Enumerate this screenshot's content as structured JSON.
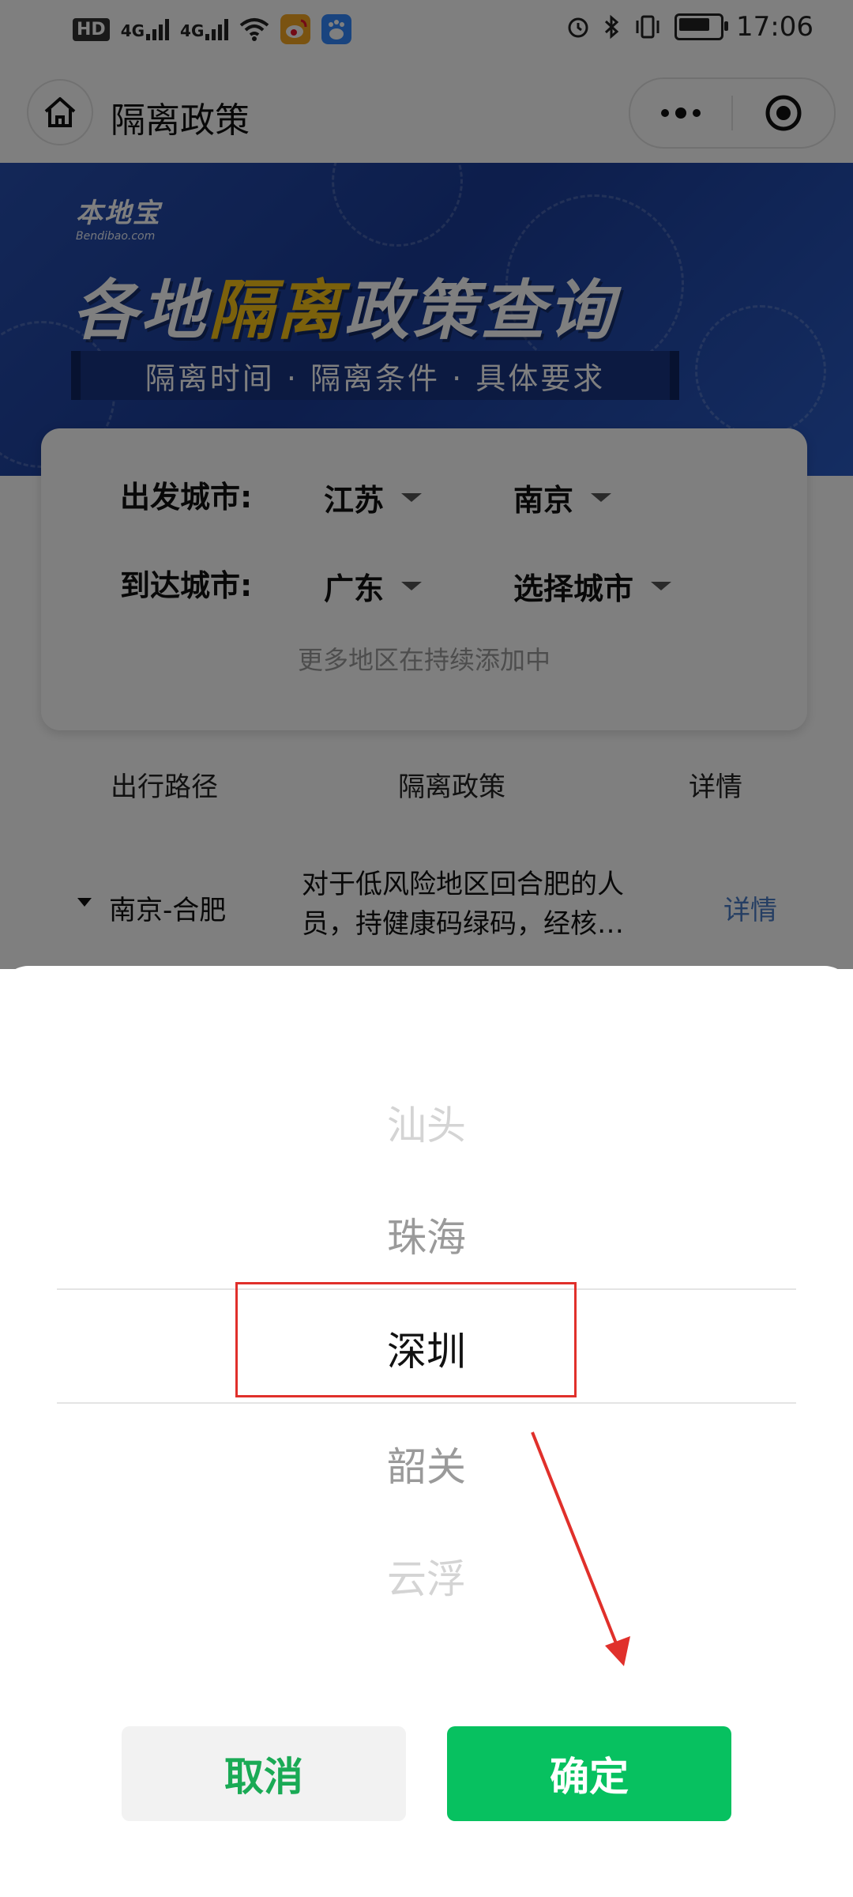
{
  "status_bar": {
    "hd": "HD",
    "network_1": "4G",
    "network_2": "4G",
    "time": "17:06",
    "icons": [
      "hd-icon",
      "signal-icon",
      "signal-icon",
      "wifi-icon",
      "weibo-app-icon",
      "baidu-app-icon",
      "alarm-icon",
      "bluetooth-icon",
      "vibrate-icon",
      "battery-icon"
    ]
  },
  "navbar": {
    "title": "隔离政策",
    "home_icon": "home-icon",
    "more_icon": "more-dots-icon",
    "close_icon": "target-close-icon"
  },
  "banner": {
    "logo_cn": "本地宝",
    "logo_en": "Bendibao.com",
    "title_part1": "各地",
    "title_highlight": "隔离",
    "title_part2": "政策查询",
    "subtitle": "隔离时间 · 隔离条件 · 具体要求",
    "colors": {
      "background": "#1a3c98",
      "highlight": "#f6c318"
    }
  },
  "query_card": {
    "departure_label": "出发城市:",
    "departure_province": "江苏",
    "departure_city": "南京",
    "arrival_label": "到达城市:",
    "arrival_province": "广东",
    "arrival_city": "选择城市",
    "note": "更多地区在持续添加中"
  },
  "table": {
    "headers": [
      "出行路径",
      "隔离政策",
      "详情"
    ],
    "rows": [
      {
        "route": "南京-合肥",
        "policy": "对于低风险地区回合肥的人员，持健康码绿码，经核…",
        "detail": "详情"
      }
    ]
  },
  "picker": {
    "options": [
      "汕头",
      "珠海",
      "深圳",
      "韶关",
      "云浮"
    ],
    "selected": "深圳",
    "cancel_label": "取消",
    "confirm_label": "确定",
    "colors": {
      "confirm": "#07c160",
      "cancel_text": "#1aaa55",
      "annotation": "#e0302b"
    }
  }
}
